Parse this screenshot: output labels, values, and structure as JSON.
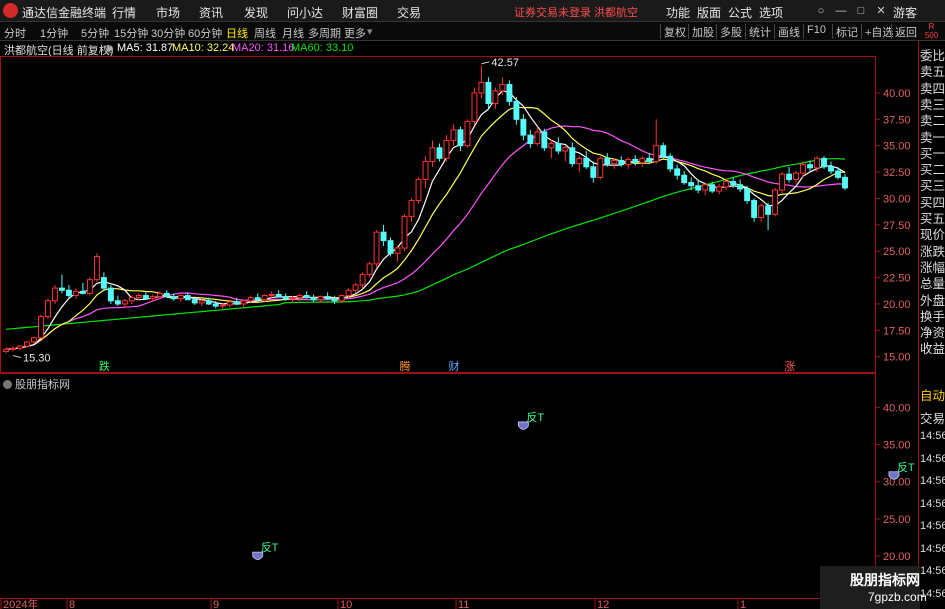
{
  "app": {
    "title": "通达信金融终端",
    "menus": [
      "行情",
      "市场",
      "资讯",
      "发现",
      "问小达",
      "财富圈",
      "交易"
    ],
    "notice": "证券交易未登录  洪都航空",
    "tools": [
      "功能",
      "版面",
      "公式",
      "选项"
    ],
    "guest": "游客"
  },
  "periods": [
    "分时",
    "1分钟",
    "5分钟",
    "15分钟",
    "30分钟",
    "60分钟",
    "日线",
    "周线",
    "月线",
    "多周期",
    "更多"
  ],
  "active_period": "日线",
  "chart_tools": [
    "复权",
    "加股",
    "多股",
    "统计",
    "画线",
    "F10",
    "标记",
    "+自选",
    "返回"
  ],
  "info": {
    "stock": "洪都航空(日线 前复权)",
    "ma5": "MA5: 31.87",
    "ma10": "MA10: 32.24",
    "ma20": "MA20: 31.16",
    "ma60": "MA60: 33.10"
  },
  "right_panel": {
    "top": "R\n500",
    "items": [
      "委比",
      "卖五",
      "卖四",
      "卖三",
      "卖二",
      "卖一",
      "买一",
      "买二",
      "买三",
      "买四",
      "买五",
      "现价",
      "涨跌",
      "涨幅",
      "总量",
      "外盘",
      "换手",
      "净资",
      "收益"
    ],
    "items2": [
      "自动",
      "交易",
      "14:56",
      "14:56",
      "14:56",
      "14:56",
      "14:56",
      "14:56",
      "14:56",
      "14:56"
    ]
  },
  "sub_chart": {
    "label": "股朋指标网"
  },
  "watermark": {
    "line1": "股朋指标网",
    "line2": "7gpzb.com"
  },
  "colors": {
    "up": "#ff3232",
    "down": "#54fcfc",
    "ma5": "#ffffff",
    "ma10": "#ffff54",
    "ma20": "#ff54ff",
    "ma60": "#00e600",
    "axis": "#a01010"
  },
  "chart_data": [
    {
      "type": "candlestick",
      "y_axis_ticks": [
        40.0,
        37.5,
        35.0,
        32.5,
        30.0,
        27.5,
        25.0,
        22.5,
        20.0,
        17.5,
        15.0
      ],
      "ylim": [
        14.5,
        43.5
      ],
      "x_axis_ticks": [
        "2024年",
        "8",
        "9",
        "10",
        "11",
        "12",
        "1"
      ],
      "annotations": [
        {
          "text": "42.57",
          "x_index": 68,
          "value": 42.57
        },
        {
          "text": "15.30",
          "x_index": 1,
          "value": 15.3
        }
      ],
      "markers": [
        {
          "text": "跌",
          "x_index": 14,
          "color": "#33ff66"
        },
        {
          "text": "腾",
          "x_index": 57,
          "color": "#ff9933"
        },
        {
          "text": "财",
          "x_index": 64,
          "color": "#66aaff"
        },
        {
          "text": "涨",
          "x_index": 112,
          "color": "#ff5555"
        }
      ],
      "candles": [
        [
          15.5,
          15.9,
          15.3,
          15.7
        ],
        [
          15.7,
          16.0,
          15.5,
          15.8
        ],
        [
          15.8,
          16.1,
          15.6,
          16.0
        ],
        [
          16.0,
          16.5,
          15.9,
          16.4
        ],
        [
          16.4,
          16.9,
          16.2,
          16.8
        ],
        [
          16.8,
          19.0,
          16.7,
          18.8
        ],
        [
          18.8,
          20.5,
          18.6,
          20.3
        ],
        [
          20.3,
          21.8,
          20.0,
          21.5
        ],
        [
          21.5,
          22.8,
          21.0,
          21.3
        ],
        [
          21.3,
          21.8,
          20.5,
          20.8
        ],
        [
          20.8,
          21.5,
          20.5,
          21.2
        ],
        [
          21.2,
          22.0,
          20.9,
          21.0
        ],
        [
          21.0,
          22.5,
          20.8,
          22.3
        ],
        [
          22.3,
          24.8,
          22.1,
          24.5
        ],
        [
          22.5,
          23.0,
          21.2,
          21.5
        ],
        [
          21.5,
          21.8,
          20.0,
          20.3
        ],
        [
          20.3,
          20.8,
          19.8,
          20.0
        ],
        [
          20.0,
          20.5,
          19.6,
          20.3
        ],
        [
          20.3,
          20.8,
          20.0,
          20.6
        ],
        [
          20.6,
          21.0,
          20.3,
          20.8
        ],
        [
          20.8,
          21.1,
          20.4,
          20.5
        ],
        [
          20.5,
          20.9,
          20.2,
          20.7
        ],
        [
          20.7,
          21.2,
          20.5,
          21.0
        ],
        [
          21.0,
          21.3,
          20.6,
          20.7
        ],
        [
          20.7,
          21.0,
          20.3,
          20.5
        ],
        [
          20.5,
          20.9,
          20.2,
          20.8
        ],
        [
          20.8,
          21.1,
          20.4,
          20.4
        ],
        [
          20.4,
          20.7,
          19.9,
          20.1
        ],
        [
          20.1,
          20.5,
          19.8,
          20.3
        ],
        [
          20.3,
          20.6,
          19.9,
          20.0
        ],
        [
          20.0,
          20.3,
          19.6,
          19.8
        ],
        [
          19.8,
          20.1,
          19.5,
          19.9
        ],
        [
          19.9,
          20.4,
          19.7,
          20.2
        ],
        [
          20.2,
          20.6,
          19.9,
          20.0
        ],
        [
          20.0,
          20.4,
          19.7,
          20.3
        ],
        [
          20.3,
          20.8,
          20.1,
          20.6
        ],
        [
          20.6,
          21.0,
          20.3,
          20.4
        ],
        [
          20.4,
          20.9,
          20.2,
          20.8
        ],
        [
          20.8,
          21.2,
          20.5,
          20.9
        ],
        [
          20.9,
          21.3,
          20.6,
          20.7
        ],
        [
          20.7,
          21.0,
          20.3,
          20.5
        ],
        [
          20.5,
          20.8,
          20.1,
          20.6
        ],
        [
          20.6,
          21.0,
          20.3,
          20.8
        ],
        [
          20.8,
          21.2,
          20.5,
          20.6
        ],
        [
          20.6,
          20.9,
          20.2,
          20.4
        ],
        [
          20.4,
          20.8,
          20.1,
          20.7
        ],
        [
          20.7,
          21.1,
          20.4,
          20.5
        ],
        [
          20.5,
          20.8,
          20.0,
          20.3
        ],
        [
          20.3,
          20.9,
          20.1,
          20.8
        ],
        [
          20.8,
          21.5,
          20.6,
          21.3
        ],
        [
          21.3,
          22.0,
          21.0,
          21.8
        ],
        [
          21.8,
          23.0,
          21.5,
          22.8
        ],
        [
          22.8,
          24.0,
          22.5,
          23.8
        ],
        [
          23.8,
          27.0,
          23.5,
          26.8
        ],
        [
          26.8,
          27.5,
          25.5,
          26.0
        ],
        [
          26.0,
          26.3,
          24.5,
          24.8
        ],
        [
          24.8,
          25.5,
          24.0,
          25.3
        ],
        [
          25.3,
          28.5,
          25.0,
          28.3
        ],
        [
          28.3,
          30.0,
          27.8,
          29.8
        ],
        [
          29.8,
          32.0,
          29.5,
          31.8
        ],
        [
          31.8,
          34.0,
          31.0,
          33.5
        ],
        [
          33.5,
          35.5,
          33.0,
          34.8
        ],
        [
          34.8,
          35.2,
          33.5,
          33.8
        ],
        [
          33.8,
          36.0,
          33.5,
          35.5
        ],
        [
          35.5,
          37.0,
          35.0,
          36.5
        ],
        [
          36.5,
          36.8,
          34.5,
          35.0
        ],
        [
          35.0,
          37.5,
          34.8,
          37.3
        ],
        [
          37.3,
          40.5,
          37.0,
          40.0
        ],
        [
          40.0,
          42.57,
          39.5,
          41.0
        ],
        [
          41.0,
          41.5,
          38.5,
          39.0
        ],
        [
          39.0,
          40.5,
          38.5,
          40.2
        ],
        [
          40.2,
          41.5,
          39.8,
          40.8
        ],
        [
          40.8,
          41.2,
          38.8,
          39.2
        ],
        [
          39.2,
          39.6,
          37.0,
          37.5
        ],
        [
          37.5,
          38.0,
          35.5,
          36.0
        ],
        [
          36.0,
          36.5,
          34.8,
          35.2
        ],
        [
          35.2,
          36.8,
          35.0,
          36.3
        ],
        [
          36.3,
          36.6,
          34.5,
          34.8
        ],
        [
          34.8,
          35.6,
          33.8,
          35.2
        ],
        [
          35.2,
          35.8,
          34.2,
          34.5
        ],
        [
          34.5,
          35.0,
          33.5,
          34.8
        ],
        [
          34.8,
          35.3,
          33.0,
          33.3
        ],
        [
          33.3,
          34.0,
          32.5,
          33.8
        ],
        [
          33.8,
          34.5,
          32.8,
          33.0
        ],
        [
          33.0,
          33.5,
          31.5,
          32.0
        ],
        [
          32.0,
          34.0,
          31.8,
          33.8
        ],
        [
          33.8,
          34.3,
          33.0,
          33.3
        ],
        [
          33.3,
          33.8,
          32.8,
          33.6
        ],
        [
          33.6,
          34.0,
          33.0,
          33.2
        ],
        [
          33.2,
          33.9,
          32.8,
          33.7
        ],
        [
          33.7,
          34.1,
          33.1,
          33.4
        ],
        [
          33.4,
          34.0,
          33.0,
          33.8
        ],
        [
          33.8,
          34.3,
          33.3,
          33.5
        ],
        [
          33.5,
          37.5,
          33.3,
          35.0
        ],
        [
          35.0,
          35.3,
          33.8,
          34.0
        ],
        [
          34.0,
          34.3,
          32.5,
          32.8
        ],
        [
          32.8,
          33.2,
          31.8,
          32.2
        ],
        [
          32.2,
          32.6,
          31.3,
          31.5
        ],
        [
          31.5,
          32.0,
          30.8,
          31.2
        ],
        [
          31.2,
          31.8,
          30.5,
          30.8
        ],
        [
          30.8,
          31.5,
          30.3,
          31.3
        ],
        [
          31.3,
          31.6,
          30.5,
          30.7
        ],
        [
          30.7,
          31.4,
          30.4,
          31.1
        ],
        [
          31.1,
          31.9,
          30.8,
          31.6
        ],
        [
          31.6,
          32.0,
          31.0,
          31.3
        ],
        [
          31.3,
          31.8,
          30.6,
          30.9
        ],
        [
          30.9,
          31.2,
          29.5,
          29.8
        ],
        [
          29.8,
          30.0,
          27.8,
          28.2
        ],
        [
          28.2,
          29.5,
          27.8,
          29.3
        ],
        [
          29.3,
          29.6,
          27.0,
          28.5
        ],
        [
          28.5,
          31.0,
          28.3,
          30.8
        ],
        [
          30.8,
          32.5,
          30.5,
          32.3
        ],
        [
          32.3,
          33.0,
          31.5,
          31.8
        ],
        [
          31.8,
          32.6,
          31.4,
          32.4
        ],
        [
          32.4,
          33.5,
          32.0,
          33.2
        ],
        [
          33.2,
          33.6,
          32.6,
          32.9
        ],
        [
          32.9,
          34.0,
          32.5,
          33.8
        ],
        [
          33.8,
          34.0,
          32.8,
          33.0
        ],
        [
          33.0,
          33.5,
          32.3,
          32.6
        ],
        [
          32.6,
          33.0,
          31.8,
          32.0
        ],
        [
          32.0,
          32.3,
          30.8,
          31.0
        ]
      ]
    },
    {
      "type": "scatter",
      "y_axis_ticks": [
        40.0,
        35.0,
        30.0,
        25.0,
        20.0
      ],
      "ylim": [
        18.0,
        43.0
      ],
      "points": [
        {
          "x_index": 36,
          "y": 20.0,
          "label": "反T"
        },
        {
          "x_index": 74,
          "y": 37.5,
          "label": "反T"
        },
        {
          "x_index": 127,
          "y": 30.8,
          "label": "反T"
        }
      ]
    }
  ]
}
